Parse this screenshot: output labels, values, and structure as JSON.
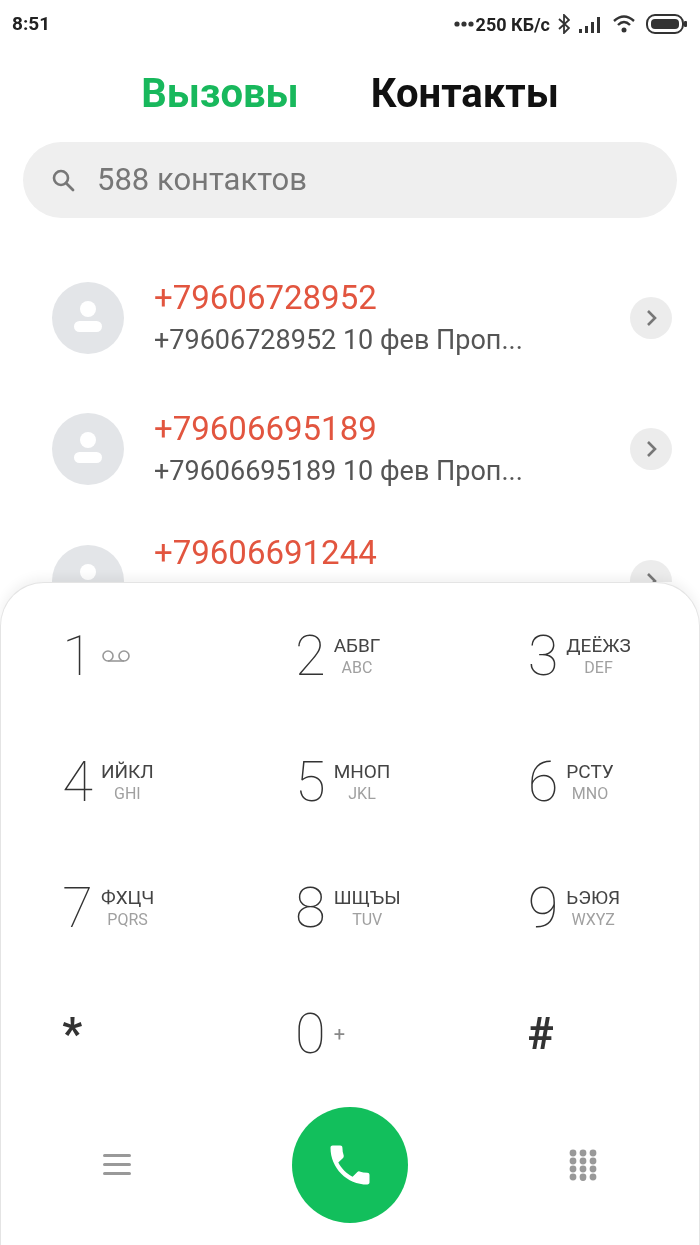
{
  "status_bar": {
    "time": "8:51",
    "speed": "250 КБ/с"
  },
  "tabs": [
    {
      "label": "Вызовы",
      "selected": true
    },
    {
      "label": "Контакты",
      "selected": false
    }
  ],
  "search": {
    "placeholder": "588 контактов"
  },
  "calls": [
    {
      "name": "+79606728952",
      "detail": "+79606728952 10 фев Проп..."
    },
    {
      "name": "+79606695189",
      "detail": "+79606695189 10 фев Проп..."
    },
    {
      "name": "+79606691244"
    }
  ],
  "keypad": [
    {
      "kind": "voicemail",
      "digit": "1"
    },
    {
      "kind": "letters",
      "digit": "2",
      "letters": "АБВГ",
      "latin": "ABC"
    },
    {
      "kind": "letters",
      "digit": "3",
      "letters": "ДЕЁЖЗ",
      "latin": "DEF"
    },
    {
      "kind": "letters",
      "digit": "4",
      "letters": "ИЙКЛ",
      "latin": "GHI"
    },
    {
      "kind": "letters",
      "digit": "5",
      "letters": "МНОП",
      "latin": "JKL"
    },
    {
      "kind": "letters",
      "digit": "6",
      "letters": "РСТУ",
      "latin": "MNO"
    },
    {
      "kind": "letters",
      "digit": "7",
      "letters": "ФХЦЧ",
      "latin": "PQRS"
    },
    {
      "kind": "letters",
      "digit": "8",
      "letters": "ШЩЪЫ",
      "latin": "TUV"
    },
    {
      "kind": "letters",
      "digit": "9",
      "letters": "ЬЭЮЯ",
      "latin": "WXYZ"
    },
    {
      "kind": "symbol",
      "digit": "*"
    },
    {
      "kind": "plus",
      "digit": "0",
      "sub": "+"
    },
    {
      "kind": "symbol",
      "digit": "#"
    }
  ]
}
